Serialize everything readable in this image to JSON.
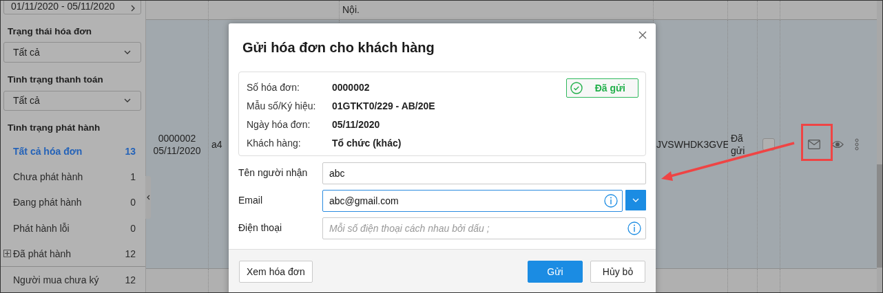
{
  "sidebar": {
    "date_range": "01/11/2020 - 05/11/2020",
    "filters": [
      {
        "label": "Trạng thái hóa đơn",
        "value": "Tất cả"
      },
      {
        "label": "Tình trạng thanh toán",
        "value": "Tất cả"
      }
    ],
    "release_status": {
      "label": "Tình trạng phát hành",
      "items": [
        {
          "label": "Tất cả hóa đơn",
          "count": "13",
          "selected": true,
          "expandable": false
        },
        {
          "label": "Chưa phát hành",
          "count": "1",
          "selected": false,
          "expandable": false
        },
        {
          "label": "Đang phát hành",
          "count": "0",
          "selected": false,
          "expandable": false
        },
        {
          "label": "Phát hành lỗi",
          "count": "0",
          "selected": false,
          "expandable": false
        },
        {
          "label": "Đã phát hành",
          "count": "12",
          "selected": false,
          "expandable": true
        }
      ]
    },
    "signature_items": [
      {
        "label": "Người mua chưa ký",
        "count": "12"
      }
    ]
  },
  "table": {
    "previous_row_text": "Nội.",
    "row": {
      "invoice_number": "0000002",
      "invoice_date": "05/11/2020",
      "template": "a4",
      "lookup_code": "JVSWHDK3GVE",
      "send_status": "Đã gửi",
      "checked": false
    }
  },
  "dialog": {
    "title": "Gửi hóa đơn cho khách hàng",
    "info": [
      {
        "label": "Số hóa đơn:",
        "value": "0000002"
      },
      {
        "label": "Mẫu số/Ký hiệu:",
        "value": "01GTKT0/229 - AB/20E"
      },
      {
        "label": "Ngày hóa đơn:",
        "value": "05/11/2020"
      },
      {
        "label": "Khách hàng:",
        "value": "Tổ chức (khác)"
      }
    ],
    "status_badge": "Đã gửi",
    "fields": [
      {
        "kind": "name",
        "label": "Tên người nhận",
        "value": "abc",
        "focused": false
      },
      {
        "kind": "email",
        "label": "Email",
        "value": "abc@gmail.com",
        "focused": true
      },
      {
        "kind": "phone",
        "label": "Điện thoại",
        "placeholder": "Mỗi số điện thoại cách nhau bởi dấu ;",
        "focused": false
      }
    ],
    "left_button": "Xem hóa đơn",
    "primary_button": "Gửi",
    "cancel_button": "Hủy bỏ"
  }
}
